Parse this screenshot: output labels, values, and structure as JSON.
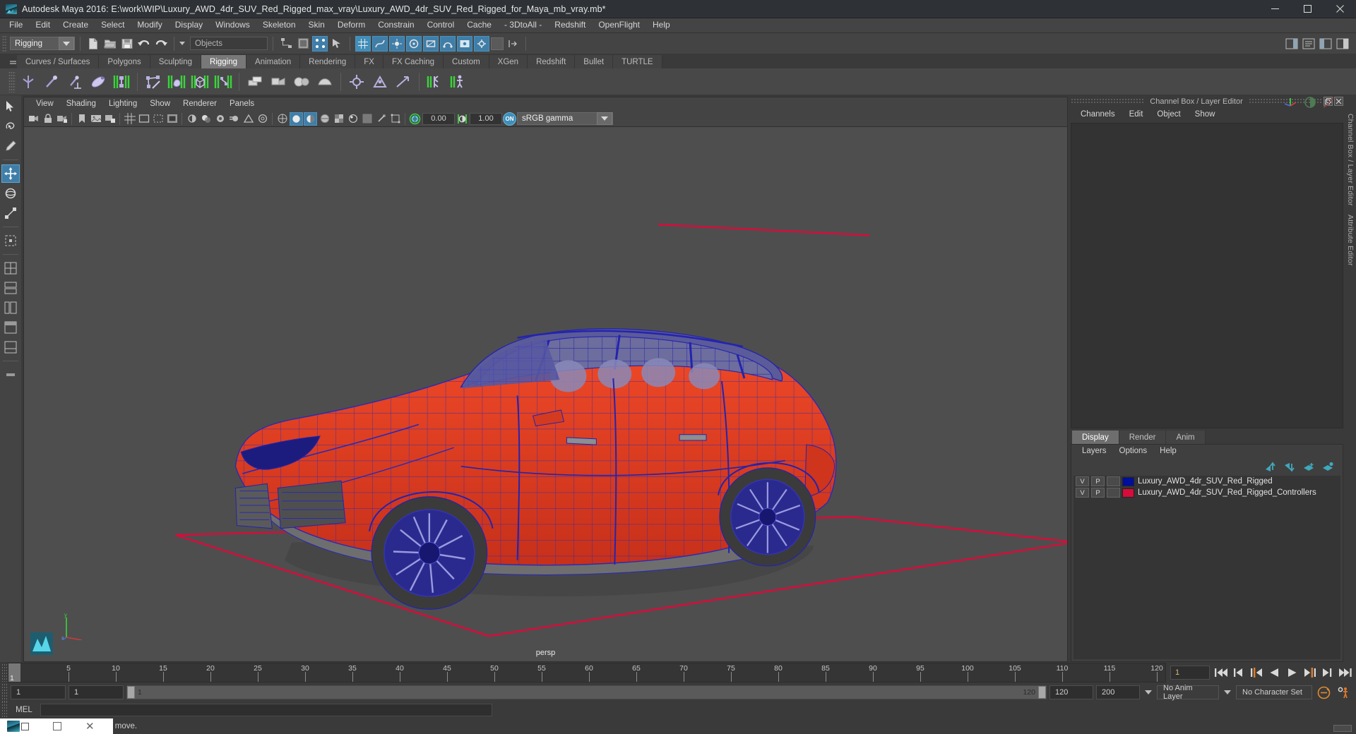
{
  "window": {
    "title": "Autodesk Maya 2016: E:\\work\\WIP\\Luxury_AWD_4dr_SUV_Red_Rigged_max_vray\\Luxury_AWD_4dr_SUV_Red_Rigged_for_Maya_mb_vray.mb*",
    "minimize": "minimize-icon",
    "maximize": "maximize-icon",
    "close": "close-icon"
  },
  "menubar": {
    "items": [
      "File",
      "Edit",
      "Create",
      "Select",
      "Modify",
      "Display",
      "Windows",
      "Skeleton",
      "Skin",
      "Deform",
      "Constrain",
      "Control",
      "Cache",
      "- 3DtoAll -",
      "Redshift",
      "OpenFlight",
      "Help"
    ]
  },
  "statusline": {
    "mode": "Rigging",
    "selection_field": "Objects",
    "icons": [
      "new-scene-icon",
      "open-scene-icon",
      "save-scene-icon",
      "undo-icon",
      "redo-icon",
      "select-by-hierarchy-icon",
      "select-by-object-icon",
      "select-by-component-icon",
      "snap-grid-icon",
      "snap-curve-icon",
      "snap-point-icon",
      "snap-view-plane-icon",
      "snap-projected-center-icon",
      "construction-history-icon",
      "render-icon",
      "lock-icon"
    ]
  },
  "shelf": {
    "tabs": [
      "Curves / Surfaces",
      "Polygons",
      "Sculpting",
      "Rigging",
      "Animation",
      "Rendering",
      "FX",
      "FX Caching",
      "Custom",
      "XGen",
      "Redshift",
      "Bullet",
      "TURTLE"
    ],
    "active_tab": "Rigging",
    "icons": [
      "create-joint-icon",
      "insert-joint-icon",
      "mirror-joint-icon",
      "ik-handle-icon",
      "ik-spline-handle-icon",
      "skeleton-set-icon",
      "bind-skin-icon",
      "interactive-bind-icon",
      "lattice-deformer-icon",
      "cluster-deformer-icon",
      "blendshape-icon",
      "wrap-icon",
      "parent-constraint-icon",
      "point-constraint-icon",
      "orient-constraint-icon",
      "aim-constraint-icon",
      "pole-vector-icon",
      "quick-rig-icon",
      "human-ik-icon"
    ]
  },
  "tools": {
    "items": [
      "select-tool",
      "lasso-select-tool",
      "paint-select-tool",
      "move-tool",
      "rotate-tool",
      "scale-tool",
      "universal-manipulator-tool",
      "soft-modification-tool",
      "last-tool-used",
      "show-manipulator-tool"
    ],
    "active": "move-tool"
  },
  "viewport": {
    "menus": [
      "View",
      "Shading",
      "Lighting",
      "Show",
      "Renderer",
      "Panels"
    ],
    "camera_label": "persp",
    "toolbar": {
      "exposure_value": "0.00",
      "gamma_value": "1.00",
      "color_management_toggle": "ON",
      "view_transform": "sRGB gamma",
      "icons": [
        "select-camera-icon",
        "lock-camera-icon",
        "camera-attributes-icon",
        "bookmark-icon",
        "image-plane-icon",
        "two-sided-lighting-icon",
        "shadows-icon",
        "screen-space-ao-icon",
        "motion-blur-icon",
        "multisample-aa-icon",
        "depth-of-field-icon",
        "grid-icon",
        "film-gate-icon",
        "resolution-gate-icon",
        "gate-mask-icon",
        "wireframe-icon",
        "smooth-shade-all-icon",
        "smooth-shade-textured-icon",
        "use-default-material-icon",
        "xray-icon",
        "xray-joints-icon",
        "xray-active-components-icon",
        "isolate-select-icon",
        "viewport-gamma-icon",
        "exposure-icon"
      ]
    },
    "scene": {
      "model_name": "Luxury AWD 4dr SUV Red Rigged",
      "body_color": "#e03a1e",
      "wireframe_color": "#1a1aa8",
      "controller_color": "#d90b3a",
      "background_color": "#4e4e4e"
    }
  },
  "right_panel": {
    "title": "Channel Box / Layer Editor",
    "undock_button": "undock-icon",
    "close_button": "close-icon",
    "channelbox_menus": [
      "Channels",
      "Edit",
      "Object",
      "Show"
    ],
    "layer_tabs": [
      "Display",
      "Render",
      "Anim"
    ],
    "layer_tabs_active": "Display",
    "layer_menus": [
      "Layers",
      "Options",
      "Help"
    ],
    "layer_toolbar_icons": [
      "move-layer-up-icon",
      "move-layer-down-icon",
      "new-layer-icon",
      "new-layer-from-selected-icon"
    ],
    "layers": [
      {
        "visibility": "V",
        "playback": "P",
        "type": "",
        "color": "#000e9e",
        "name": "Luxury_AWD_4dr_SUV_Red_Rigged"
      },
      {
        "visibility": "V",
        "playback": "P",
        "type": "",
        "color": "#d90b3a",
        "name": "Luxury_AWD_4dr_SUV_Red_Rigged_Controllers"
      }
    ],
    "side_tabs": [
      "Channel Box / Layer Editor",
      "Attribute Editor"
    ]
  },
  "timeline": {
    "current_frame": "1",
    "start_visible": "1",
    "ticks": [
      5,
      10,
      15,
      20,
      25,
      30,
      35,
      40,
      45,
      50,
      55,
      60,
      65,
      70,
      75,
      80,
      85,
      90,
      95,
      100,
      105,
      110,
      115,
      120
    ],
    "playback_buttons": [
      "go-to-start-icon",
      "step-back-frame-icon",
      "step-back-key-icon",
      "play-backwards-icon",
      "play-forwards-icon",
      "step-forward-key-icon",
      "step-forward-frame-icon",
      "go-to-end-icon"
    ]
  },
  "range": {
    "anim_start": "1",
    "range_start": "1",
    "range_bar_start": "1",
    "range_bar_end": "120",
    "range_end": "120",
    "anim_end": "200",
    "anim_layer": "No Anim Layer",
    "character_set": "No Character Set",
    "auto_key_icon": "auto-keyframe-icon",
    "anim_prefs_icon": "animation-preferences-icon"
  },
  "command_line": {
    "language": "MEL",
    "input_value": "",
    "output_value": ""
  },
  "statusbar": {
    "message": "to move."
  },
  "taskbar": {
    "app_icon": "maya-app-icon",
    "restore_icon": "restore-icon",
    "maximize_icon": "maximize-icon",
    "close_icon": "close-icon"
  }
}
